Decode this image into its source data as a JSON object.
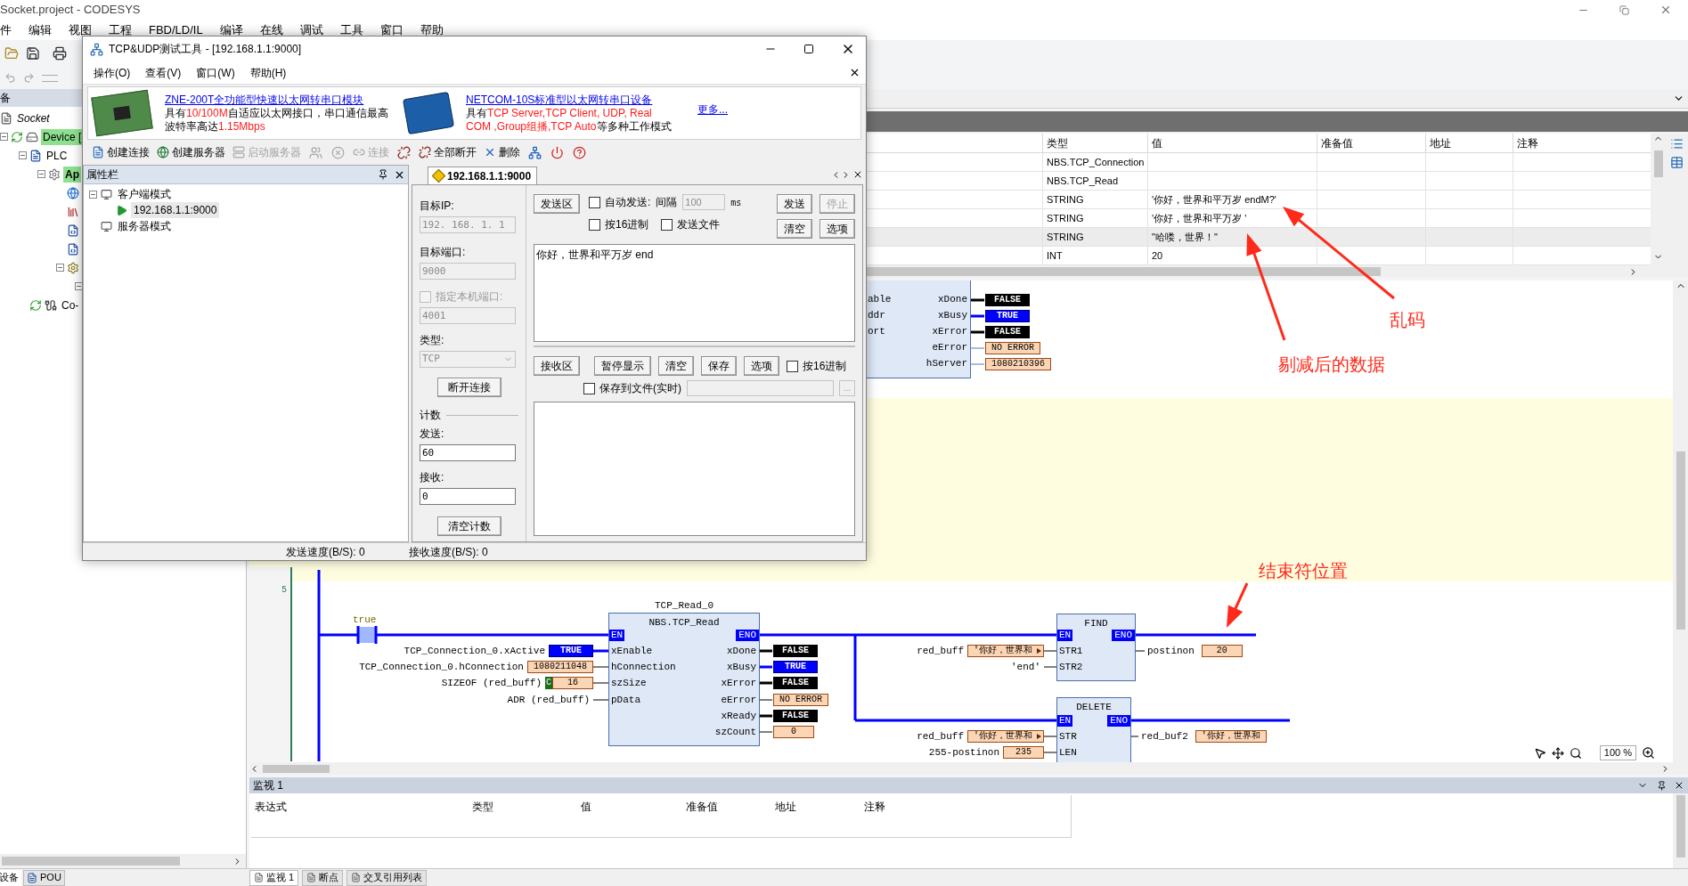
{
  "app": {
    "title": "Socket.project - CODESYS",
    "menu": [
      "件",
      "编辑",
      "视图",
      "工程",
      "FBD/LD/IL",
      "编译",
      "在线",
      "调试",
      "工具",
      "窗口",
      "帮助"
    ]
  },
  "devices": {
    "header": "备",
    "tree": [
      {
        "kind": "project",
        "label": "Socket",
        "children": [
          {
            "kind": "device",
            "label": "Device [",
            "highlighted": true,
            "expanded": true,
            "children": [
              {
                "kind": "plc",
                "label": "PLC",
                "highlighted": false,
                "expanded": true,
                "children": [
                  {
                    "kind": "app",
                    "label": "Ap",
                    "highlighted": true,
                    "expanded": true,
                    "children": [
                      {
                        "kind": "globe"
                      },
                      {
                        "kind": "library"
                      },
                      {
                        "kind": "pou"
                      },
                      {
                        "kind": "pou"
                      },
                      {
                        "kind": "task",
                        "expanded": true,
                        "children": [
                          {
                            "expanded": true
                          }
                        ]
                      }
                    ]
                  }
                ]
              },
              {
                "kind": "coupler",
                "label": "Co-",
                "highlighted": false
              }
            ]
          }
        ]
      }
    ],
    "tabs": [
      {
        "label": "设备",
        "selected": true
      },
      {
        "label": "POU",
        "selected": false
      }
    ]
  },
  "variables": {
    "columns": [
      "类型",
      "值",
      "准备值",
      "地址",
      "注释"
    ],
    "rows": [
      {
        "type": "NBS.TCP_Connection",
        "selected": false
      },
      {
        "type": "NBS.TCP_Read",
        "selected": false
      },
      {
        "type": "STRING",
        "value": "'你好，世界和平万岁 endM?'",
        "selected": false
      },
      {
        "type": "STRING",
        "value": "'你好，世界和平万岁 '",
        "selected": false
      },
      {
        "type": "STRING",
        "value": "\"哈喽，世界！\"",
        "selected": true
      },
      {
        "type": "INT",
        "value": "20",
        "selected": false
      }
    ]
  },
  "ladder": {
    "top_block": {
      "inputs": [
        "able",
        "ddr",
        "ort"
      ],
      "outputs": [
        {
          "pin": "xDone",
          "value": "FALSE",
          "kind": "false"
        },
        {
          "pin": "xBusy",
          "value": "TRUE",
          "kind": "true"
        },
        {
          "pin": "xError",
          "value": "FALSE",
          "kind": "false"
        },
        {
          "pin": "eError",
          "value": "NO ERROR",
          "kind": "value"
        },
        {
          "pin": "hServer",
          "value": "1080210396",
          "kind": "value"
        }
      ]
    },
    "rung": {
      "number": "5",
      "contact": "true",
      "read_block": {
        "instance": "TCP_Read_0",
        "type": "NBS.TCP_Read",
        "en": "EN",
        "eno": "ENO",
        "inputs": [
          {
            "pin": "xEnable",
            "expr": "TCP_Connection_0.xActive",
            "value": "TRUE",
            "kind": "true"
          },
          {
            "pin": "hConnection",
            "expr": "TCP_Connection_0.hConnection",
            "value": "1080211048",
            "kind": "value"
          },
          {
            "pin": "szSize",
            "expr": "SIZEOF (red_buff)",
            "badge": "C",
            "value": "16",
            "kind": "value"
          },
          {
            "pin": "pData",
            "expr": "ADR (red_buff)"
          }
        ],
        "outputs": [
          {
            "pin": "xDone",
            "value": "FALSE",
            "kind": "false"
          },
          {
            "pin": "xBusy",
            "value": "TRUE",
            "kind": "true"
          },
          {
            "pin": "xError",
            "value": "FALSE",
            "kind": "false"
          },
          {
            "pin": "eError",
            "value": "NO ERROR",
            "kind": "value"
          },
          {
            "pin": "xReady",
            "value": "FALSE",
            "kind": "false"
          },
          {
            "pin": "szCount",
            "value": "0",
            "kind": "value"
          }
        ]
      },
      "find_block": {
        "type": "FIND",
        "en": "EN",
        "eno": "ENO",
        "inputs": [
          {
            "pin": "STR1",
            "expr": "red_buff",
            "value": "'你好，世界和",
            "kind": "string"
          },
          {
            "pin": "STR2",
            "expr": "'end'"
          }
        ],
        "outputs": [
          {
            "expr": "postinon",
            "value": "20",
            "kind": "value"
          }
        ]
      },
      "delete_block": {
        "type": "DELETE",
        "en": "EN",
        "eno": "ENO",
        "inputs": [
          {
            "pin": "STR",
            "expr": "red_buff",
            "value": "'你好，世界和",
            "kind": "string"
          },
          {
            "pin": "LEN",
            "expr": "255-postinon",
            "value": "235",
            "kind": "value"
          }
        ],
        "outputs": [
          {
            "expr": "red_buf2",
            "value": "'你好，世界和",
            "kind": "value"
          }
        ]
      }
    },
    "zoom": "100 %"
  },
  "watch": {
    "title": "监视 1",
    "columns": [
      "表达式",
      "类型",
      "值",
      "准备值",
      "地址",
      "注释"
    ],
    "tabs": [
      {
        "label": "监视 1",
        "selected": true
      },
      {
        "label": "断点",
        "selected": false
      },
      {
        "label": "交叉引用列表",
        "selected": false
      }
    ]
  },
  "annotations": [
    "乱码",
    "剔减后的数据",
    "结束符位置"
  ],
  "tool_window": {
    "title": "TCP&UDP测试工具 - [192.168.1.1:9000]",
    "menu": [
      "操作(O)",
      "查看(V)",
      "窗口(W)",
      "帮助(H)"
    ],
    "ads": [
      {
        "title": "ZNE-200T全功能型快速以太网转串口模块",
        "lines": [
          [
            {
              "text": "具有",
              "highlight": false
            },
            {
              "text": "10/100M",
              "highlight": true
            },
            {
              "text": "自适应以太网接口，串口通信最高",
              "highlight": false
            }
          ],
          [
            {
              "text": "波特率高达",
              "highlight": false
            },
            {
              "text": "1.15Mbps",
              "highlight": true
            }
          ]
        ]
      },
      {
        "title": "NETCOM-10S标准型以太网转串口设备",
        "lines": [
          [
            {
              "text": "具有",
              "highlight": false
            },
            {
              "text": "TCP Server,TCP Client, UDP, Real",
              "highlight": true
            }
          ],
          [
            {
              "text": "COM ,Group组播,TCP Auto",
              "highlight": true
            },
            {
              "text": "等多种工作模式",
              "highlight": false
            }
          ]
        ]
      }
    ],
    "more": "更多...",
    "toolbar": [
      {
        "kind": "create_connection",
        "label": "创建连接",
        "disabled": false
      },
      {
        "kind": "create_server",
        "label": "创建服务器",
        "disabled": false
      },
      {
        "kind": "start_server",
        "label": "启动服务器",
        "disabled": true
      },
      {
        "kind": "users",
        "disabled": true
      },
      {
        "kind": "stop",
        "disabled": true
      },
      {
        "kind": "connect",
        "label": "连接",
        "disabled": true
      },
      {
        "kind": "disconnect",
        "disabled": false
      },
      {
        "kind": "disconnect_all",
        "label": "全部断开",
        "disabled": false
      },
      {
        "kind": "delete",
        "label": "删除",
        "disabled": false
      },
      {
        "kind": "network",
        "disabled": false
      },
      {
        "kind": "power",
        "disabled": false
      },
      {
        "kind": "help",
        "disabled": false
      }
    ],
    "properties": {
      "title": "属性栏",
      "tree": [
        {
          "label": "客户端模式",
          "expanded": true,
          "selected": false,
          "children": [
            {
              "label": "192.168.1.1:9000",
              "selected": true
            }
          ]
        },
        {
          "label": "服务器模式",
          "selected": false
        }
      ]
    },
    "tabs": [
      {
        "label": "192.168.1.1:9000",
        "selected": true
      }
    ],
    "settings": {
      "disabled": true,
      "ip_label": "目标IP:",
      "ip": "192. 168. 1. 1",
      "port_label": "目标端口:",
      "port": "9000",
      "local_port": {
        "label": "指定本机端口:",
        "checked": false
      },
      "local_port_value": "4001",
      "type_label": "类型:",
      "type": "TCP",
      "disconnect": "断开连接",
      "count_label": "计数",
      "sent_label": "发送:",
      "sent": "60",
      "received_label": "接收:",
      "received": "0",
      "clear_count": "清空计数"
    },
    "send": {
      "area": "发送区",
      "auto_send": {
        "label": "自动发送:",
        "checked": false
      },
      "interval_label": "间隔",
      "interval": "100",
      "unit": "ms",
      "send": "发送",
      "stop": {
        "label": "停止",
        "disabled": true
      },
      "hex": {
        "label": "按16进制",
        "checked": false
      },
      "file": {
        "label": "发送文件",
        "checked": false
      },
      "clear": "清空",
      "options": "选项",
      "text": "你好，世界和平万岁 end"
    },
    "receive": {
      "area": "接收区",
      "pause": "暂停显示",
      "clear": "清空",
      "save": "保存",
      "options": "选项",
      "hex": {
        "label": "按16进制",
        "checked": false
      },
      "save_file": {
        "label": "保存到文件(实时)",
        "checked": false
      },
      "browse": "..."
    },
    "status": [
      "发送速度(B/S): 0",
      "接收速度(B/S): 0"
    ]
  }
}
